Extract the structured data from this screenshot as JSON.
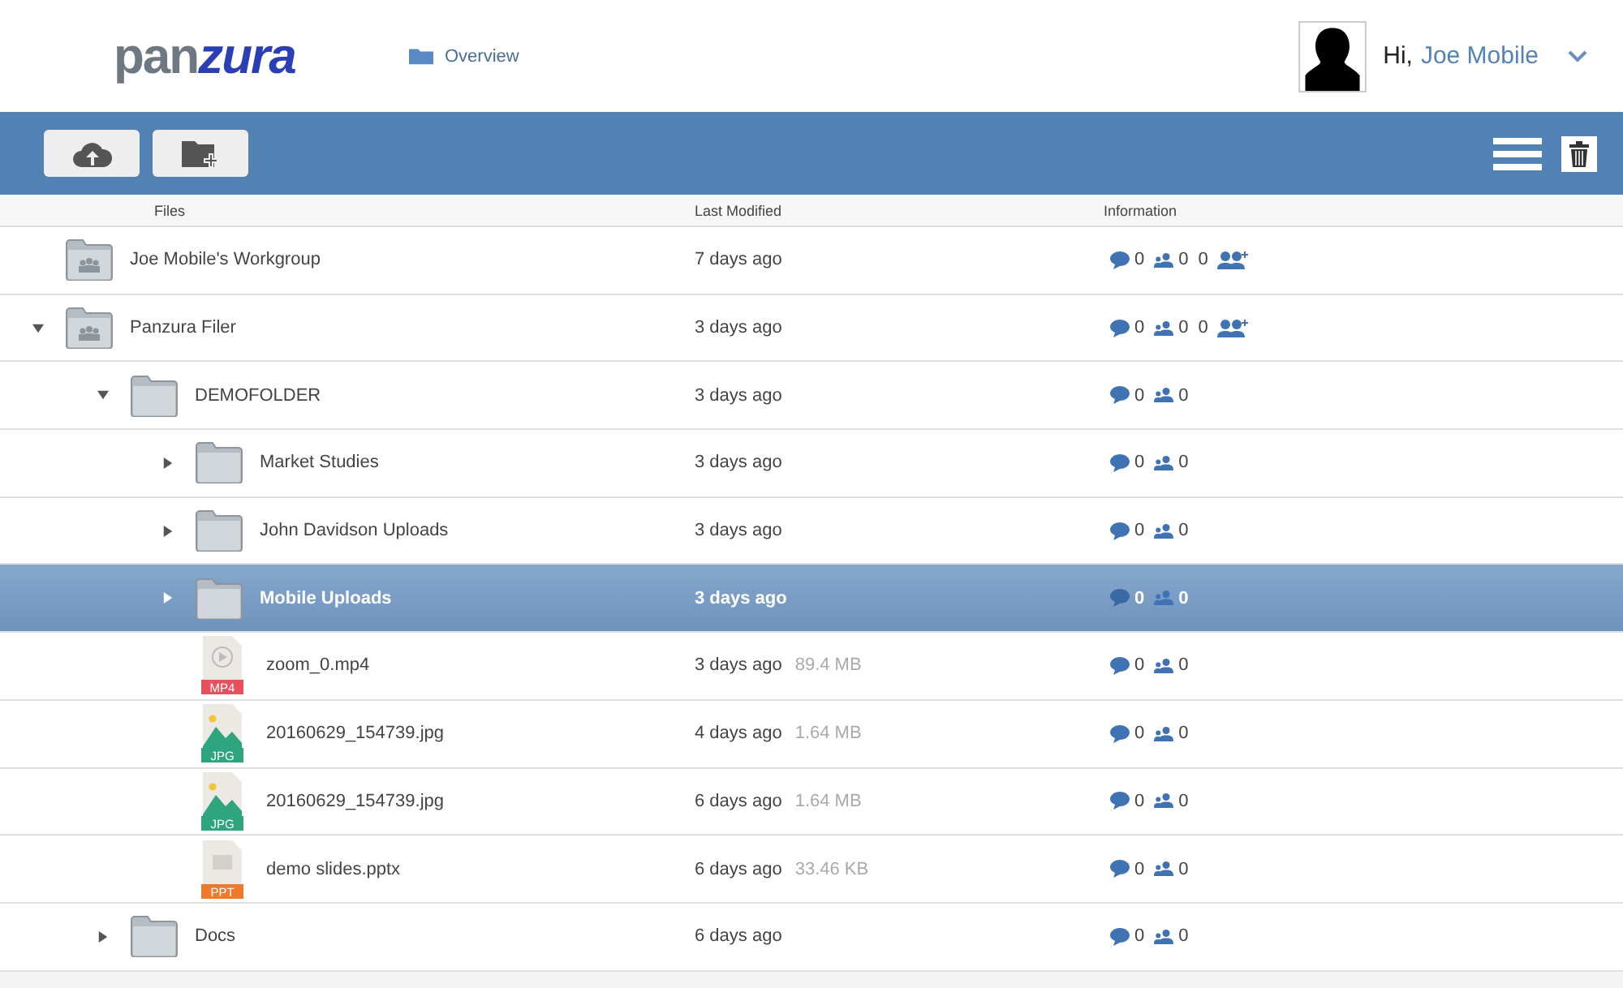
{
  "header": {
    "logo": [
      "pan",
      "zura"
    ],
    "nav": {
      "label": "Overview"
    },
    "greeting": "Hi,",
    "user": "Joe Mobile"
  },
  "columns": [
    "Files",
    "Last Modified",
    "Information"
  ],
  "tree": [
    {
      "kind": "workgroup",
      "name": "Joe Mobile's Workgroup",
      "modified": "7 days ago",
      "comments": "0",
      "members": "0",
      "invites": "0",
      "selected": false
    },
    {
      "kind": "workgroup",
      "name": "Panzura Filer",
      "modified": "3 days ago",
      "comments": "0",
      "members": "0",
      "invites": "0",
      "selected": false,
      "expanded": true,
      "children": [
        {
          "kind": "folder",
          "name": "DEMOFOLDER",
          "modified": "3 days ago",
          "comments": "0",
          "members": "0",
          "selected": false,
          "expanded": true,
          "children": [
            {
              "kind": "folder",
              "name": "Market Studies",
              "modified": "3 days ago",
              "comments": "0",
              "members": "0",
              "selected": false,
              "expanded": false
            },
            {
              "kind": "folder",
              "name": "John Davidson Uploads",
              "modified": "3 days ago",
              "comments": "0",
              "members": "0",
              "selected": false,
              "expanded": false
            },
            {
              "kind": "folder",
              "name": "Mobile Uploads",
              "modified": "3 days ago",
              "comments": "0",
              "members": "0",
              "selected": true,
              "expanded": false
            },
            {
              "kind": "video",
              "badge": "MP4",
              "name": "zoom_0.mp4",
              "modified": "3 days ago",
              "size": "89.4 MB",
              "comments": "0",
              "members": "0",
              "selected": false
            },
            {
              "kind": "image",
              "badge": "JPG",
              "name": "20160629_154739.jpg",
              "modified": "4 days ago",
              "size": "1.64 MB",
              "comments": "0",
              "members": "0",
              "selected": false
            },
            {
              "kind": "image",
              "badge": "JPG",
              "name": "20160629_154739.jpg",
              "modified": "6 days ago",
              "size": "1.64 MB",
              "comments": "0",
              "members": "0",
              "selected": false
            },
            {
              "kind": "slides",
              "badge": "PPT",
              "name": "demo slides.pptx",
              "modified": "6 days ago",
              "size": "33.46 KB",
              "comments": "0",
              "members": "0",
              "selected": false
            }
          ]
        },
        {
          "kind": "folder",
          "name": "Docs",
          "modified": "6 days ago",
          "comments": "0",
          "members": "0",
          "selected": false,
          "expanded": false
        }
      ]
    }
  ]
}
